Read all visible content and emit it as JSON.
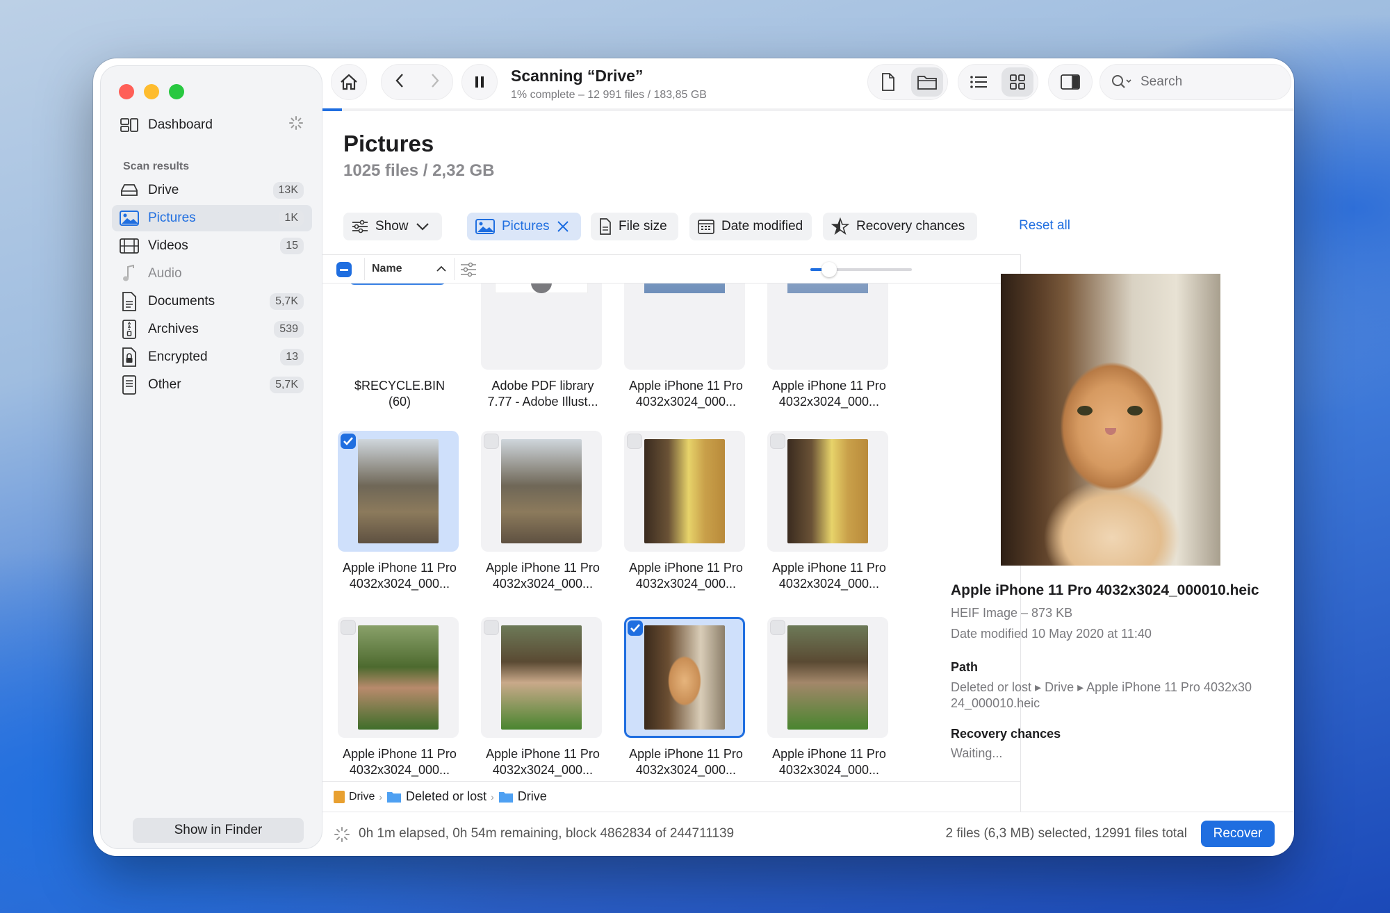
{
  "sidebar": {
    "dashboard_label": "Dashboard",
    "section_title": "Scan results",
    "items": [
      {
        "label": "Drive",
        "badge": "13K",
        "icon": "drive-icon"
      },
      {
        "label": "Pictures",
        "badge": "1K",
        "icon": "pictures-icon",
        "selected": true
      },
      {
        "label": "Videos",
        "badge": "15",
        "icon": "videos-icon"
      },
      {
        "label": "Audio",
        "badge": "",
        "icon": "audio-icon"
      },
      {
        "label": "Documents",
        "badge": "5,7K",
        "icon": "documents-icon"
      },
      {
        "label": "Archives",
        "badge": "539",
        "icon": "archives-icon"
      },
      {
        "label": "Encrypted",
        "badge": "13",
        "icon": "encrypted-icon"
      },
      {
        "label": "Other",
        "badge": "5,7K",
        "icon": "other-icon"
      }
    ],
    "show_in_finder": "Show in Finder"
  },
  "toolbar": {
    "title": "Scanning “Drive”",
    "subtitle": "1% complete – 12 991 files / 183,85 GB",
    "search_placeholder": "Search",
    "progress_fraction": 0.01
  },
  "main": {
    "title": "Pictures",
    "subtitle": "1025 files / 2,32 GB",
    "filters": {
      "show": "Show",
      "pictures": "Pictures",
      "file_size": "File size",
      "date_modified": "Date modified",
      "recovery_chances": "Recovery chances",
      "reset_all": "Reset all"
    },
    "column_name": "Name",
    "rows": [
      [
        {
          "line1": "$RECYCLE.BIN",
          "line2": "(60)"
        },
        {
          "line1": "Adobe PDF library",
          "line2": "7.77 - Adobe Illust..."
        },
        {
          "line1": "Apple iPhone 11 Pro",
          "line2": "4032x3024_000..."
        },
        {
          "line1": "Apple iPhone 11 Pro",
          "line2": "4032x3024_000..."
        }
      ],
      [
        {
          "line1": "Apple iPhone 11 Pro",
          "line2": "4032x3024_000...",
          "checked": true
        },
        {
          "line1": "Apple iPhone 11 Pro",
          "line2": "4032x3024_000..."
        },
        {
          "line1": "Apple iPhone 11 Pro",
          "line2": "4032x3024_000..."
        },
        {
          "line1": "Apple iPhone 11 Pro",
          "line2": "4032x3024_000..."
        }
      ],
      [
        {
          "line1": "Apple iPhone 11 Pro",
          "line2": "4032x3024_000..."
        },
        {
          "line1": "Apple iPhone 11 Pro",
          "line2": "4032x3024_000..."
        },
        {
          "line1": "Apple iPhone 11 Pro",
          "line2": "4032x3024_000...",
          "checked": true
        },
        {
          "line1": "Apple iPhone 11 Pro",
          "line2": "4032x3024_000..."
        }
      ]
    ],
    "path": {
      "drive": "Drive",
      "lost": "Deleted or lost",
      "folder": "Drive"
    }
  },
  "preview": {
    "filename": "Apple iPhone 11 Pro 4032x3024_000010.heic",
    "type_size": "HEIF Image – 873 KB",
    "date_label": "Date modified",
    "date_value": "10 May 2020 at 11:40",
    "path_label": "Path",
    "path_value": "Deleted or lost ▸ Drive ▸ Apple iPhone 11 Pro 4032x30 24_000010.heic",
    "recovery_label": "Recovery chances",
    "recovery_value": "Waiting..."
  },
  "status": {
    "elapsed": "0h 1m elapsed, 0h 54m remaining, block 4862834 of 244711139",
    "selected": "2 files (6,3 MB) selected, 12991 files total",
    "recover": "Recover"
  },
  "colors": {
    "accent": "#1f6ee0",
    "close": "#ff5f57",
    "minimize": "#febc2e",
    "zoom": "#28c840"
  }
}
